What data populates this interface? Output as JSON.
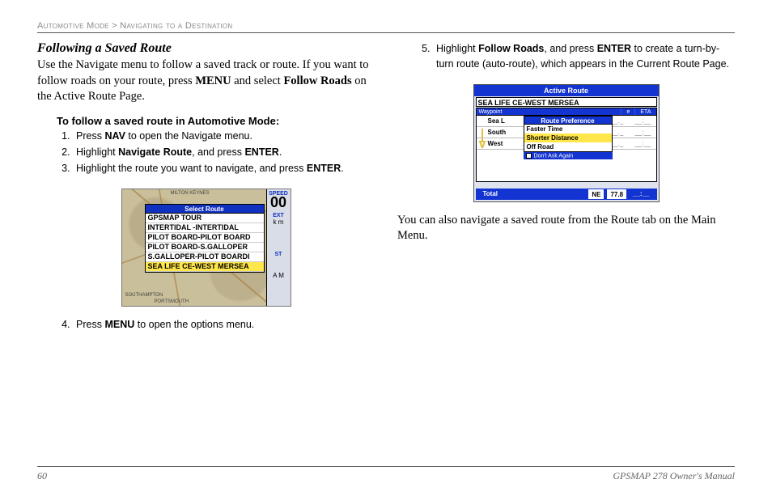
{
  "breadcrumb": {
    "a": "Automotive Mode",
    "sep": ">",
    "b": "Navigating to a Destination"
  },
  "title": "Following a Saved Route",
  "intro": {
    "pre": "Use the Navigate menu to follow a saved track or route. If you want to follow roads on your route, press ",
    "kw1": "MENU",
    "mid": " and select ",
    "kw2": "Follow Roads",
    "post": " on the Active Route Page."
  },
  "subhead": "To follow a saved route in Automotive Mode:",
  "steps": [
    {
      "a": "Press ",
      "b": "NAV",
      "c": " to open the Navigate menu."
    },
    {
      "a": "Highlight ",
      "b": "Navigate Route",
      "c": ", and press ",
      "d": "ENTER",
      "e": "."
    },
    {
      "a": "Highlight the route you want to navigate, and press ",
      "b": "ENTER",
      "c": "."
    },
    {
      "a": "Press ",
      "b": "MENU",
      "c": " to open the options menu."
    },
    {
      "a": "Highlight ",
      "b": "Follow Roads",
      "c": ", and press ",
      "d": "ENTER",
      "e": " to create a turn-by-turn route (auto-route), which appears in the Current Route Page."
    }
  ],
  "fig1": {
    "right": {
      "speed_lbl": "SPEED",
      "speed": "00",
      "ext": "EXT",
      "st": "ST",
      "km": "k m",
      "am": "A M"
    },
    "popup_title": "Select Route",
    "items": [
      "GPSMAP TOUR",
      "INTERTIDAL -INTERTIDAL",
      "PILOT BOARD-PILOT BOARD",
      "PILOT BOARD-S.GALLOPER",
      "S.GALLOPER-PILOT BOARDI",
      "SEA LIFE CE-WEST MERSEA"
    ],
    "selected_index": 5,
    "map_top": "MILTON KEYNES",
    "map_bl": "SOUTHAMPTON",
    "map_bl2": "PORTSMOUTH"
  },
  "fig2": {
    "title": "Active Route",
    "route": "SEA LIFE CE-WEST MERSEA",
    "cols": [
      "Waypoint",
      "e",
      "ETA"
    ],
    "rows": [
      {
        "label": "Sea L",
        "v1": "__._",
        "v2": "__:__"
      },
      {
        "label": "South",
        "v1": "__._",
        "v2": "__:__"
      },
      {
        "label": "West",
        "v1": "__._",
        "v2": "__:__"
      }
    ],
    "pref_title": "Route Preference",
    "prefs": [
      "Faster Time",
      "Shorter Distance",
      "Off Road"
    ],
    "pref_selected_index": 1,
    "dont_ask": "Don't Ask Again",
    "total": {
      "label": "Total",
      "dir": "NE",
      "dist": "77.8",
      "eta": "__:__"
    }
  },
  "closing": "You can also navigate a saved route from the Route tab on the Main Menu.",
  "footer": {
    "page": "60",
    "manual": "GPSMAP 278 Owner's Manual"
  }
}
